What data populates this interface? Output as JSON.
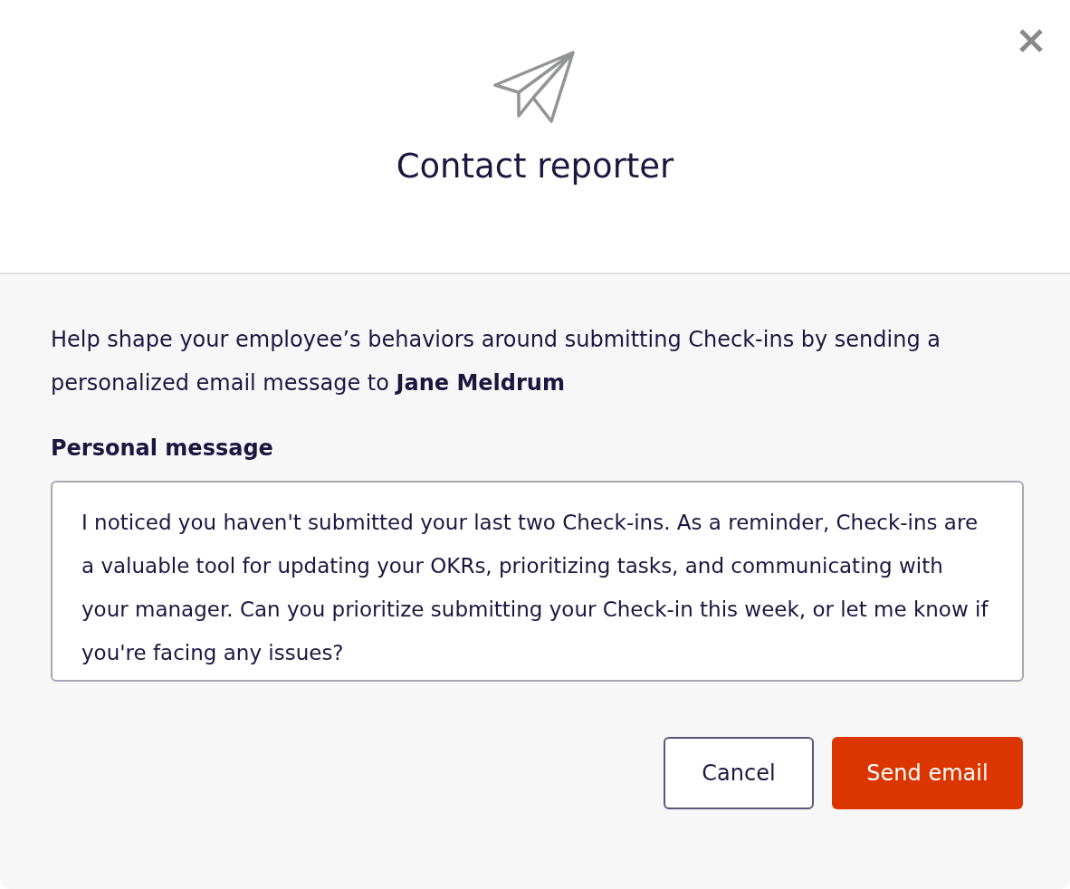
{
  "dialog": {
    "title": "Contact reporter",
    "description": "Help shape your employee’s behaviors around submitting Check-ins by sending a personalized email message to **Jane Meldrum**",
    "message_field": {
      "label": "Personal message",
      "value": "I noticed you haven't submitted your last two Check-ins. As a reminder, Check-ins are a valuable tool for updating your OKRs, prioritizing tasks, and communicating with your manager. Can you prioritize submitting your Check-in this week, or let me know if you're facing any issues?"
    },
    "buttons": [
      {
        "label": "Cancel",
        "kind": "secondary"
      },
      {
        "label": "Send email",
        "kind": "primary"
      }
    ]
  }
}
